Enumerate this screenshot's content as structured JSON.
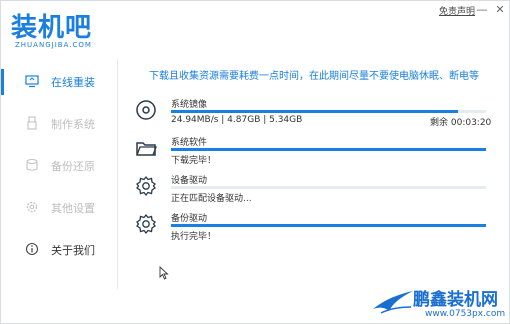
{
  "app": {
    "logo_title": "装机吧",
    "logo_subtitle": "ZHUANGJIBA.COM"
  },
  "header": {
    "disclaimer_label": "免责声明",
    "minimize_glyph": "—",
    "close_glyph": "✕"
  },
  "sidebar": {
    "items": [
      {
        "label": "在线重装",
        "icon": "monitor-icon",
        "active": true
      },
      {
        "label": "制作系统",
        "icon": "usb-icon",
        "active": false
      },
      {
        "label": "备份还原",
        "icon": "backup-icon",
        "active": false
      },
      {
        "label": "其他设置",
        "icon": "settings-icon",
        "active": false
      },
      {
        "label": "关于我们",
        "icon": "info-icon",
        "active": false
      }
    ]
  },
  "main": {
    "notice": "下载且收集资源需要耗费一点时间，在此期间尽量不要使电脑休眠、断电等",
    "tasks": [
      {
        "name": "系统镜像",
        "icon": "disc-icon",
        "status": "24.94MB/s | 4.87GB | 5.34GB",
        "remaining": "剩余 00:03:20",
        "progress": 0.91
      },
      {
        "name": "系统软件",
        "icon": "folder-icon",
        "status": "下载完毕！",
        "remaining": "",
        "progress": 1.0
      },
      {
        "name": "设备驱动",
        "icon": "gear-icon",
        "status": "正在匹配设备驱动...",
        "remaining": "",
        "progress": 0.0
      },
      {
        "name": "备份驱动",
        "icon": "gear-icon",
        "status": "执行完毕！",
        "remaining": "",
        "progress": 1.0
      }
    ]
  },
  "watermark": {
    "text": "鹏鑫装机网",
    "url": "www.0753px.com"
  },
  "colors": {
    "accent": "#1a7fe0",
    "inactive": "#bdbdbd"
  }
}
